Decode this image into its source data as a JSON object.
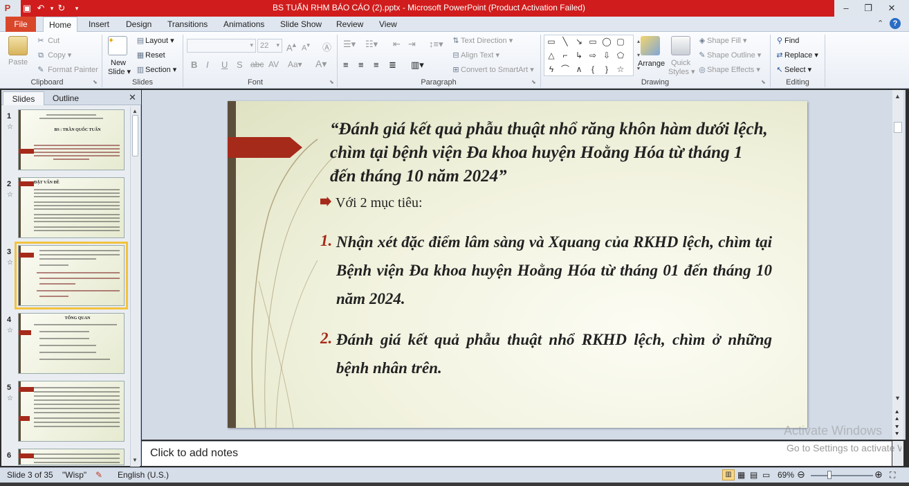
{
  "window": {
    "title": "BS TUẤN RHM BÁO CÁO (2).pptx - Microsoft PowerPoint (Product Activation Failed)"
  },
  "tabs": [
    "File",
    "Home",
    "Insert",
    "Design",
    "Transitions",
    "Animations",
    "Slide Show",
    "Review",
    "View"
  ],
  "ribbon": {
    "clipboard": {
      "paste": "Paste",
      "cut": "Cut",
      "copy": "Copy",
      "format_painter": "Format Painter",
      "label": "Clipboard"
    },
    "slides": {
      "new_slide_1": "New",
      "new_slide_2": "Slide",
      "layout": "Layout",
      "reset": "Reset",
      "section": "Section",
      "label": "Slides"
    },
    "font": {
      "size": "22",
      "label": "Font"
    },
    "paragraph": {
      "text_direction": "Text Direction",
      "align_text": "Align Text",
      "convert_smartart": "Convert to SmartArt",
      "label": "Paragraph"
    },
    "drawing": {
      "arrange": "Arrange",
      "quick_styles_1": "Quick",
      "quick_styles_2": "Styles",
      "shape_fill": "Shape Fill",
      "shape_outline": "Shape Outline",
      "shape_effects": "Shape Effects",
      "label": "Drawing"
    },
    "editing": {
      "find": "Find",
      "replace": "Replace",
      "select": "Select",
      "label": "Editing"
    }
  },
  "panel": {
    "tab_slides": "Slides",
    "tab_outline": "Outline",
    "thumbs": [
      {
        "num": "1",
        "title": "BS : TRẦN QUỐC TUẤN"
      },
      {
        "num": "2",
        "title": "ĐẶT VẤN ĐỀ"
      },
      {
        "num": "3",
        "title": ""
      },
      {
        "num": "4",
        "title": "TỔNG QUAN"
      },
      {
        "num": "5",
        "title": ""
      },
      {
        "num": "6",
        "title": ""
      }
    ]
  },
  "slide": {
    "title": "“Đánh giá kết quả phẫu thuật nhổ răng khôn hàm dưới lệch, chìm tại bệnh viện Đa khoa huyện Hoằng Hóa từ tháng 1 đến tháng 10 năm 2024”",
    "subhead": "Với 2 mục tiêu:",
    "objectives": [
      {
        "num": "1.",
        "text": "Nhận xét đặc điểm lâm sàng và Xquang của RKHD lệch, chìm tại Bệnh viện Đa khoa huyện Hoằng Hóa từ tháng 01 đến tháng 10 năm 2024."
      },
      {
        "num": "2.",
        "text": "Đánh giá kết quả phẫu thuật nhổ RKHD lệch, chìm ở những bệnh nhân trên."
      }
    ]
  },
  "notes": {
    "placeholder": "Click to add notes"
  },
  "watermark": {
    "line1": "Activate Windows",
    "line2": "Go to Settings to activate Windows."
  },
  "status": {
    "slide": "Slide 3 of 35",
    "theme": "\"Wisp\"",
    "language": "English (U.S.)",
    "zoom": "69%"
  },
  "colors": {
    "title_bar": "#d01c1c",
    "file_tab": "#d9472b",
    "accent_red": "#a52a1a"
  }
}
